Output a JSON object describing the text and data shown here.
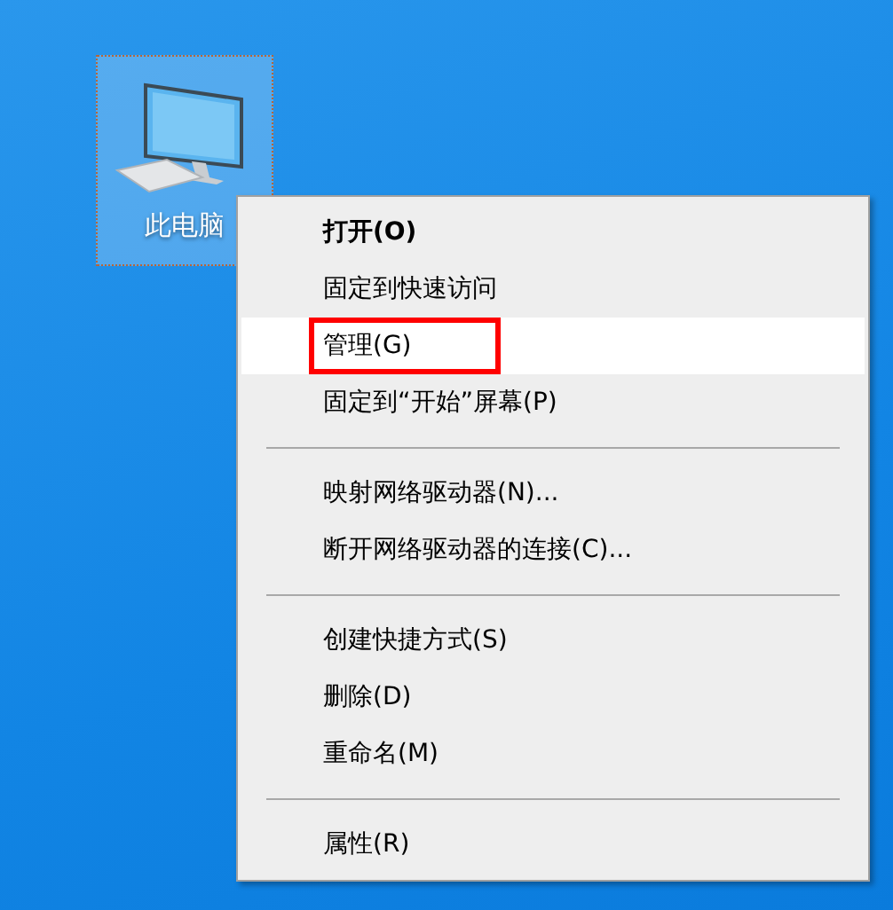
{
  "desktop_icon": {
    "label": "此电脑",
    "selected": true
  },
  "context_menu": {
    "items": [
      {
        "kind": "item",
        "label": "打开(O)",
        "bold": true,
        "selected": false,
        "annotated": false
      },
      {
        "kind": "item",
        "label": "固定到快速访问",
        "bold": false,
        "selected": false,
        "annotated": false
      },
      {
        "kind": "item",
        "label": "管理(G)",
        "bold": false,
        "selected": true,
        "annotated": true
      },
      {
        "kind": "item",
        "label": "固定到“开始”屏幕(P)",
        "bold": false,
        "selected": false,
        "annotated": false
      },
      {
        "kind": "separator"
      },
      {
        "kind": "item",
        "label": "映射网络驱动器(N)...",
        "bold": false,
        "selected": false,
        "annotated": false
      },
      {
        "kind": "item",
        "label": "断开网络驱动器的连接(C)...",
        "bold": false,
        "selected": false,
        "annotated": false
      },
      {
        "kind": "separator"
      },
      {
        "kind": "item",
        "label": "创建快捷方式(S)",
        "bold": false,
        "selected": false,
        "annotated": false
      },
      {
        "kind": "item",
        "label": "删除(D)",
        "bold": false,
        "selected": false,
        "annotated": false
      },
      {
        "kind": "item",
        "label": "重命名(M)",
        "bold": false,
        "selected": false,
        "annotated": false
      },
      {
        "kind": "separator"
      },
      {
        "kind": "item",
        "label": "属性(R)",
        "bold": false,
        "selected": false,
        "annotated": false
      }
    ]
  }
}
